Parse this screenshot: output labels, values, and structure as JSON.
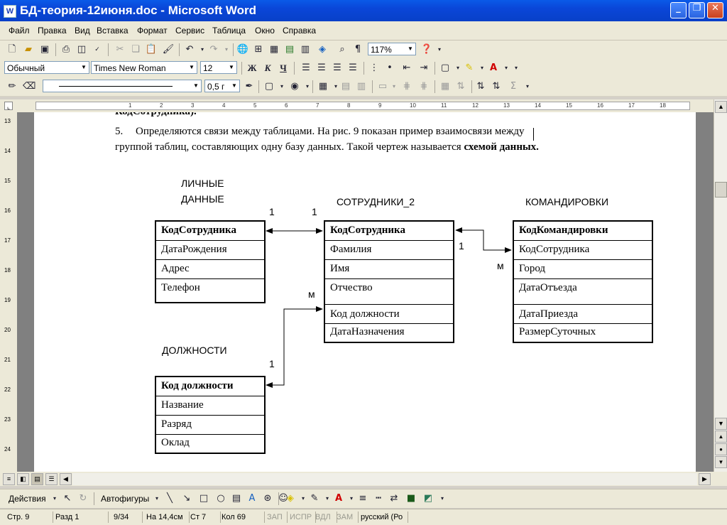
{
  "window": {
    "title": "БД-теория-12июня.doc - Microsoft Word",
    "icon_letter": "W",
    "min": "_",
    "max": "❐",
    "close": "✕"
  },
  "menu": [
    "Файл",
    "Правка",
    "Вид",
    "Вставка",
    "Формат",
    "Сервис",
    "Таблица",
    "Окно",
    "Справка"
  ],
  "toolbar1": {
    "zoom": "117%"
  },
  "toolbar2": {
    "style": "Обычный",
    "font": "Times New Roman",
    "size": "12",
    "bold": "Ж",
    "italic": "К",
    "underline": "Ч"
  },
  "toolbar3": {
    "line_width": "0,5 г"
  },
  "document": {
    "line0": "КодСотрудника).",
    "item_number": "5.",
    "line1": "Определяются связи между таблицами. На рис. 9 показан пример взаимосвязи между",
    "line2_pre": "группой таблиц, составляющих одну базу данных. Такой чертеж называется ",
    "line2_bold": "схемой данных."
  },
  "diagram": {
    "personal": {
      "title1": "ЛИЧНЫЕ",
      "title2": "ДАННЫЕ",
      "rows": [
        "КодСотрудника",
        "ДатаРождения",
        "Адрес",
        "Телефон"
      ]
    },
    "employees": {
      "title": "СОТРУДНИКИ_2",
      "rows": [
        "КодСотрудника",
        "Фамилия",
        "Имя",
        "Отчество",
        "Код должности",
        "ДатаНазначения"
      ]
    },
    "trips": {
      "title": "КОМАНДИРОВКИ",
      "rows": [
        "КодКомандировки",
        "КодСотрудника",
        "Город",
        "ДатаОтъезда",
        "ДатаПриезда",
        "РазмерСуточных"
      ]
    },
    "positions": {
      "title": "ДОЛЖНОСТИ",
      "rows": [
        "Код должности",
        "Название",
        "Разряд",
        "Оклад"
      ]
    },
    "cardinality": {
      "one": "1",
      "many": "м"
    }
  },
  "drawing_toolbar": {
    "actions": "Действия",
    "autoshapes": "Автофигуры"
  },
  "status": {
    "page": "Стр. 9",
    "section": "Разд 1",
    "pages": "9/34",
    "at": "На 14,4см",
    "line": "Ст 7",
    "col": "Кол 69",
    "rec": "ЗАП",
    "trk": "ИСПР",
    "ext": "ВДЛ",
    "ovr": "ЗАМ",
    "lang": "русский (Ро"
  },
  "colors": {
    "titlebar": "#0a46d8",
    "chrome": "#ece9d8",
    "page": "#ffffff",
    "workspace": "#808080"
  }
}
